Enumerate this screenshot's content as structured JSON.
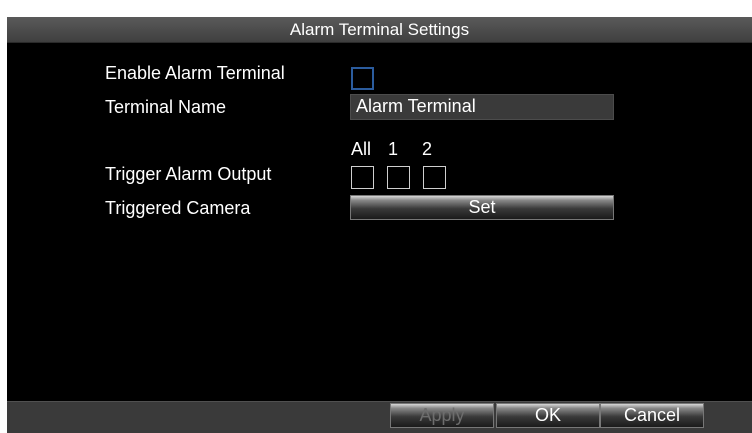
{
  "dialog": {
    "title": "Alarm Terminal Settings"
  },
  "form": {
    "enable_label": "Enable Alarm Terminal",
    "enable_checked": false,
    "name_label": "Terminal Name",
    "name_value": "Alarm Terminal",
    "trigger_label": "Trigger Alarm Output",
    "output_headers": [
      "All",
      "1",
      "2"
    ],
    "camera_label": "Triggered Camera",
    "set_button": "Set"
  },
  "footer": {
    "apply": "Apply",
    "ok": "OK",
    "cancel": "Cancel"
  }
}
